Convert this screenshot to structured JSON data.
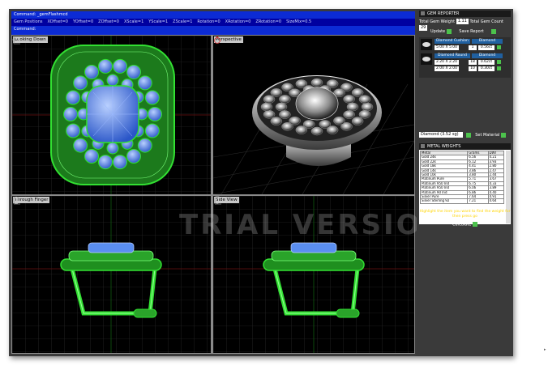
{
  "command": {
    "line1": "Command: _gemFlashmcd",
    "options": [
      "Gem Positions",
      "XOffset=0",
      "YOffset=0",
      "ZOffset=0",
      "XScale=1",
      "YScale=1",
      "ZScale=1",
      "Rotation=0",
      "XRotation=0",
      "ZRotation=0",
      "SizeMix=0.5"
    ],
    "line3": "Command:"
  },
  "viewports": {
    "top_left": "Looking Down",
    "top_right": "Perspective",
    "bottom_left": "Through Finger",
    "bottom_right": "Side View"
  },
  "watermark": "TRIAL VERSION",
  "panel": {
    "title": "GEM REPORTER",
    "total_weight_label": "Total Gem Weight",
    "total_weight_value": "1.11",
    "total_count_label": "Total Gem Count",
    "total_count_value": "29",
    "update_label": "Update",
    "save_label": "Save Report",
    "gems": [
      {
        "name": "Diamond Cushion",
        "type": "Diamond",
        "size": "5.00 X 5.00",
        "count": "1",
        "weight": "0.56ct"
      },
      {
        "name": "Diamond Round",
        "type": "Diamond",
        "size": "2.20 X 2.20",
        "count": "18",
        "weight": "0.62ct"
      },
      {
        "name": "",
        "type": "",
        "size": "2.00 X 2.00",
        "count": "10",
        "weight": "0.30ct"
      }
    ],
    "material_select": "Diamond (3.52 sg)",
    "set_material_label": "Set Material",
    "metal_weights_title": "METAL WEIGHTS",
    "metal_columns": [
      "Metal",
      "Grams",
      "DWT"
    ],
    "metals": [
      [
        "Gold 24k",
        "6.56",
        "4.21"
      ],
      [
        "Gold 22k",
        "6.12",
        "3.93"
      ],
      [
        "Gold 18k",
        "4.41",
        "2.80"
      ],
      [
        "Gold 14k",
        "3.86",
        "2.47"
      ],
      [
        "Gold 10k",
        "3.80",
        "2.44"
      ],
      [
        "Platinum  Pure",
        "5.71",
        "3.67"
      ],
      [
        "Platinum 950 Ind",
        "6.75",
        "4.33"
      ],
      [
        "Platinum 950 Ind",
        "6.06",
        "3.89"
      ],
      [
        "Platinum 90 Ind",
        "6.86",
        "4.40"
      ],
      [
        "Silver  Pure",
        "7.64",
        "4.91"
      ],
      [
        "Silver  Sterling 92",
        "7.21",
        "4.64"
      ]
    ],
    "hint": "Highlight the item you want to find the weight for then press go",
    "calculate_label": "Calculate"
  },
  "colors": {
    "command_bg": "#0c2bd4",
    "panel_bg": "#3a3a3a",
    "wire_green": "#32e032",
    "gem_blue": "#5a8ef0",
    "hint_yellow": "#ffd400"
  }
}
